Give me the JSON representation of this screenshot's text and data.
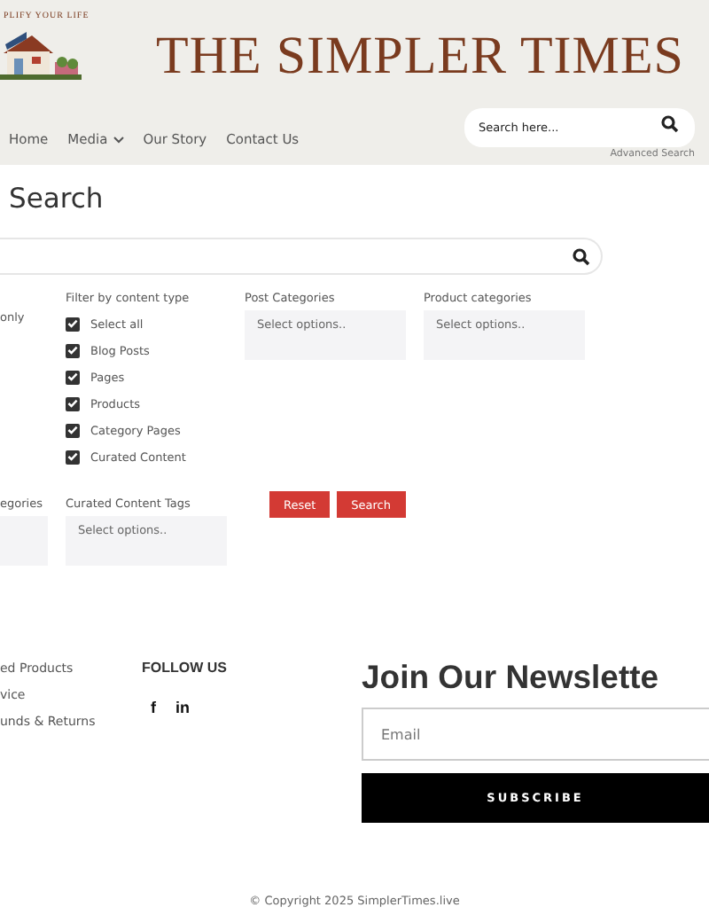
{
  "header": {
    "tagline": "PLIFY YOUR LIFE",
    "title": "THE SIMPLER TIMES",
    "nav": [
      {
        "label": "Home",
        "has_menu": false
      },
      {
        "label": "Media",
        "has_menu": true
      },
      {
        "label": "Our Story",
        "has_menu": false
      },
      {
        "label": "Contact Us",
        "has_menu": false
      }
    ],
    "search": {
      "placeholder": "Search here..."
    },
    "advanced_link": "Advanced Search"
  },
  "page_title": "Search",
  "filters": {
    "left_fragment": "only",
    "content_type": {
      "label": "Filter by content type",
      "options": [
        {
          "label": "Select all",
          "checked": true
        },
        {
          "label": "Blog Posts",
          "checked": true
        },
        {
          "label": "Pages",
          "checked": true
        },
        {
          "label": "Products",
          "checked": true
        },
        {
          "label": "Category Pages",
          "checked": true
        },
        {
          "label": "Curated Content",
          "checked": true
        }
      ]
    },
    "selects": [
      {
        "label": "Post Categories",
        "placeholder": "Select options.."
      },
      {
        "label": "Product categories",
        "placeholder": "Select options.."
      }
    ],
    "lower_selects": [
      {
        "label": "egories"
      },
      {
        "label": "Curated Content Tags",
        "placeholder": "Select options.."
      }
    ],
    "buttons": [
      "Reset",
      "Search"
    ]
  },
  "footer": {
    "links": [
      "ed Products",
      "vice",
      "unds & Returns"
    ],
    "follow_title": "FOLLOW US",
    "social": [
      "f",
      "in"
    ],
    "newsletter": {
      "title": "Join Our Newslette",
      "placeholder": "Email",
      "button": "SUBSCRIBE"
    },
    "copyright": "© Copyright 2025 SimplerTimes.live"
  }
}
